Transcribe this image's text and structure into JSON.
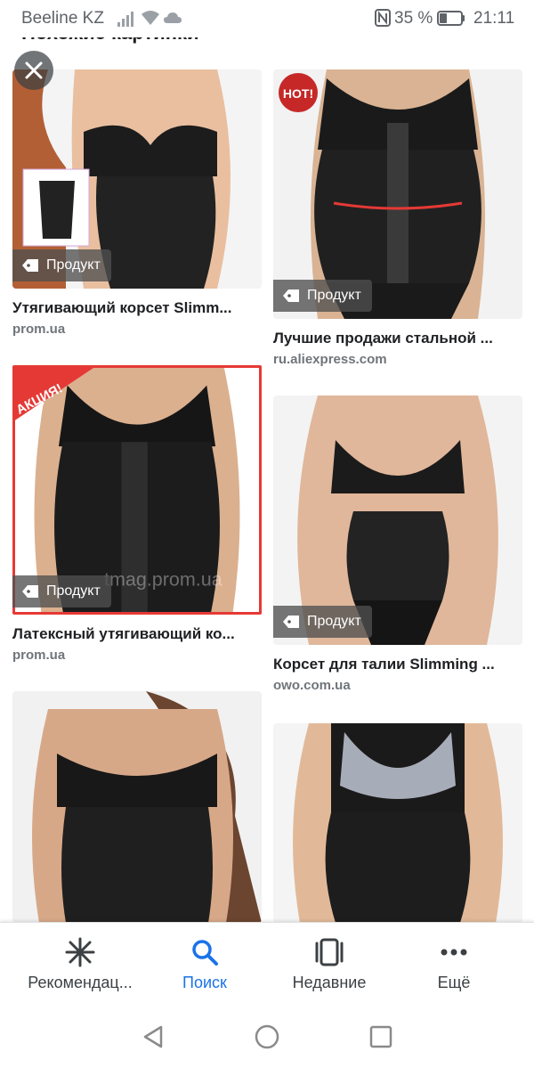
{
  "status_bar": {
    "carrier": "Beeline KZ",
    "battery_percent": "35 %",
    "battery_level": 0.35,
    "time": "21:11",
    "icons": [
      "signal-icon",
      "wifi-icon",
      "cloud-icon",
      "nfc-icon",
      "battery-icon"
    ]
  },
  "header": {
    "title": "Похожие картинки"
  },
  "close_button": {
    "icon": "close-icon"
  },
  "results": [
    {
      "title": "Утягивающий корсет Slimm...",
      "source": "prom.ua",
      "badge": "Продукт",
      "badge_icon": "tag-icon"
    },
    {
      "title": "Лучшие продажи стальной ...",
      "source": "ru.aliexpress.com",
      "badge": "Продукт",
      "badge_icon": "tag-icon",
      "sticker": "HOT!"
    },
    {
      "title": "Латексный утягивающий ко...",
      "source": "prom.ua",
      "badge": "Продукт",
      "badge_icon": "tag-icon",
      "sticker": "АКЦИЯ!",
      "watermark": "tmag.prom.ua"
    },
    {
      "title": "Корсет для талии Slimming ...",
      "source": "owo.com.ua",
      "badge": "Продукт",
      "badge_icon": "tag-icon"
    },
    {
      "title": "",
      "source": ""
    },
    {
      "title": "",
      "source": ""
    }
  ],
  "bottom_nav": {
    "items": [
      {
        "label": "Рекомендац...",
        "icon": "asterisk-icon",
        "active": false
      },
      {
        "label": "Поиск",
        "icon": "search-icon",
        "active": true
      },
      {
        "label": "Недавние",
        "icon": "recent-tabs-icon",
        "active": false
      },
      {
        "label": "Ещё",
        "icon": "more-dots-icon",
        "active": false
      }
    ]
  },
  "system_nav": {
    "buttons": [
      "back-icon",
      "home-icon",
      "recents-icon"
    ]
  },
  "colors": {
    "accent": "#1a73e8",
    "text": "#202124",
    "secondary": "#70757a",
    "badge_bg": "#505050",
    "sticker_red": "#d32f2f"
  }
}
